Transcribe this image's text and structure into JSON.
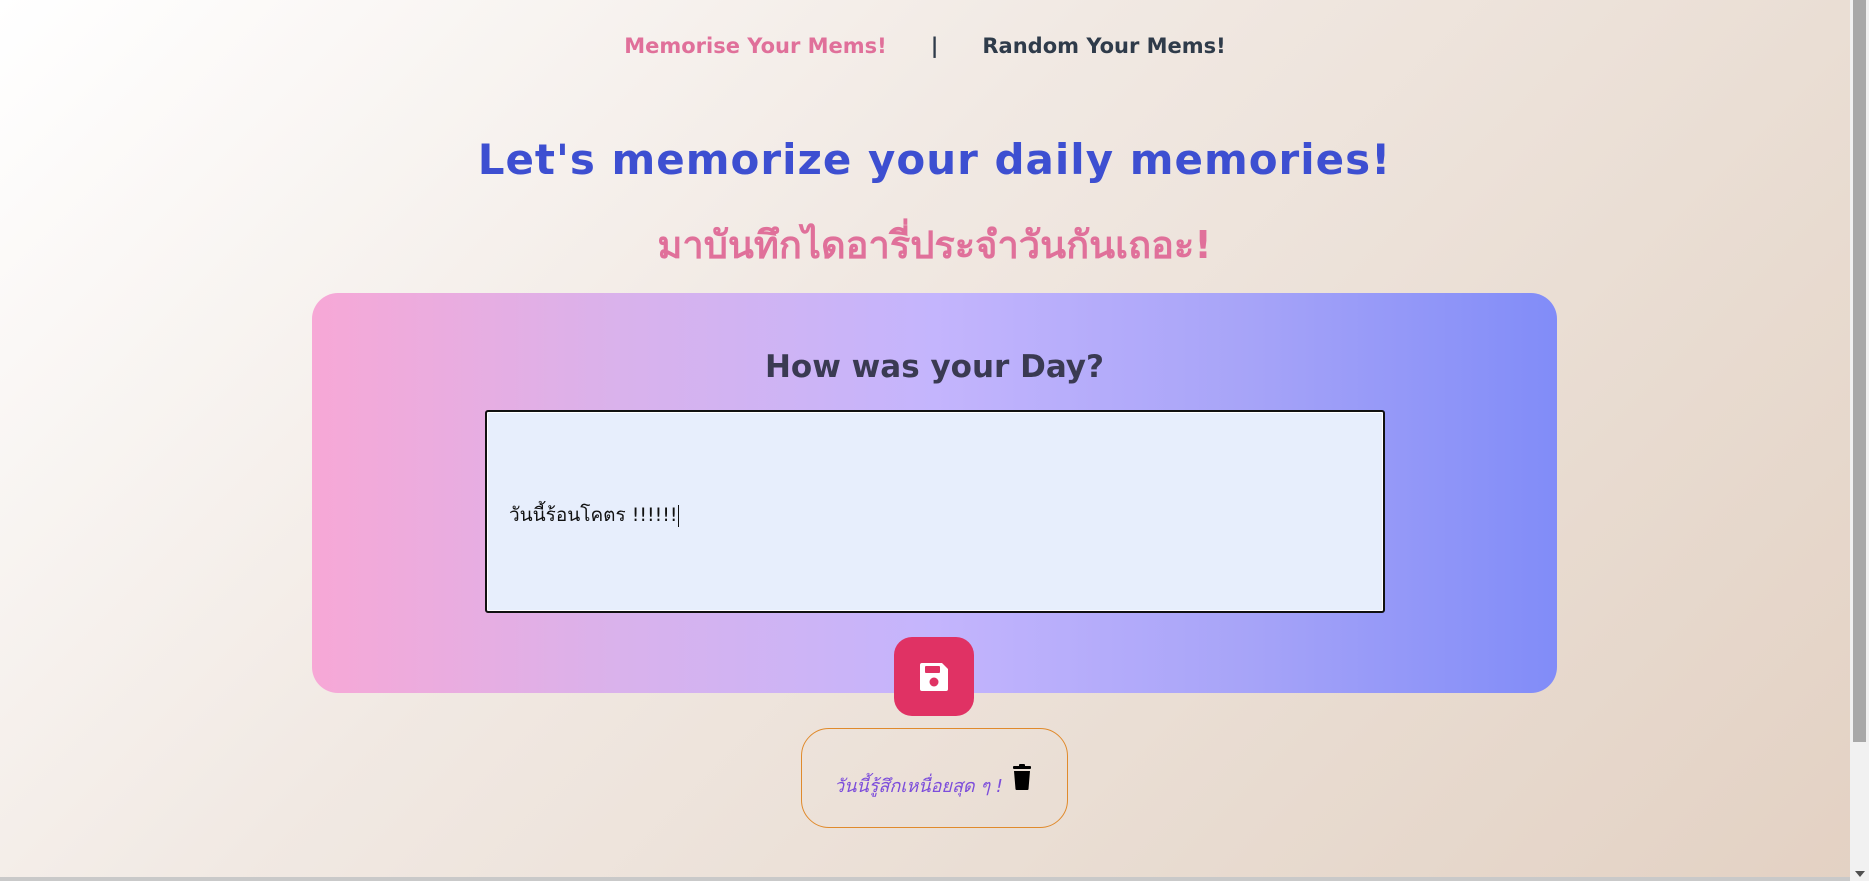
{
  "nav": {
    "memorise": "Memorise Your Mems!",
    "separator": "|",
    "random": "Random Your Mems!"
  },
  "header": {
    "title_en": "Let's memorize your daily memories!",
    "title_th": "มาบันทึกไดอารี่ประจำวันกันเถอะ!"
  },
  "card": {
    "heading": "How was your Day?",
    "editor_value": "วันนี้ร้อนโคตร !!!!!!"
  },
  "entries": [
    {
      "text": "วันนี้รู้สึกเหนื่อยสุด ๆ !"
    }
  ],
  "colors": {
    "accent_pink": "#e0709a",
    "accent_blue": "#3d4fd1",
    "save_button": "#e03264",
    "entry_border": "#e08a2c",
    "entry_text": "#7c4ddb"
  },
  "icons": {
    "save": "floppy-disk-icon",
    "delete": "trash-icon"
  }
}
